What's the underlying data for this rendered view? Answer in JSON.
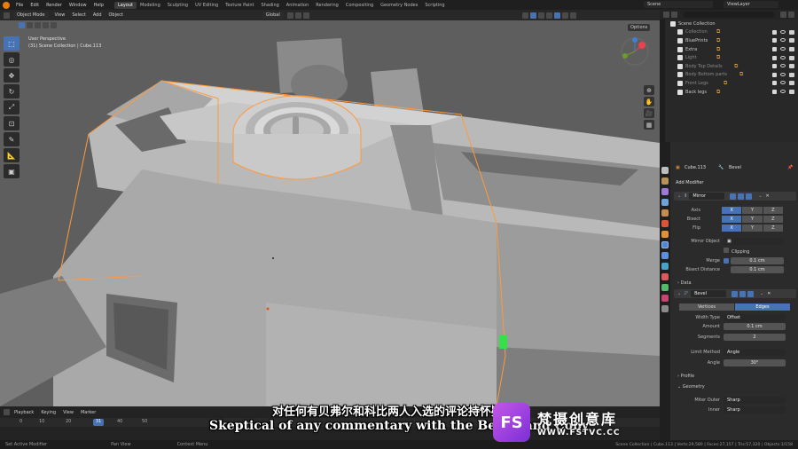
{
  "menu": {
    "items": [
      "File",
      "Edit",
      "Render",
      "Window",
      "Help"
    ],
    "workspaces": [
      "Layout",
      "Modeling",
      "Sculpting",
      "UV Editing",
      "Texture Paint",
      "Shading",
      "Animation",
      "Rendering",
      "Compositing",
      "Geometry Nodes",
      "Scripting"
    ],
    "active_workspace": "Layout",
    "scene": "Scene",
    "view_layer": "ViewLayer"
  },
  "viewport": {
    "mode": "Object Mode",
    "menus": [
      "View",
      "Select",
      "Add",
      "Object"
    ],
    "transform_orientation": "Global",
    "options": "Options",
    "perspective_label": "User Perspective",
    "collection_label": "(31) Scene Collection | Cube.113"
  },
  "outliner": {
    "root": "Scene Collection",
    "items": [
      {
        "name": "Collection",
        "dim": true
      },
      {
        "name": "BluePrints",
        "dim": false
      },
      {
        "name": "Extra",
        "dim": false
      },
      {
        "name": "Light",
        "dim": true
      },
      {
        "name": "Body Top Details",
        "dim": true
      },
      {
        "name": "Body Bottom parts",
        "dim": true
      },
      {
        "name": "Front Legs",
        "dim": true
      },
      {
        "name": "Back legs",
        "dim": false
      }
    ]
  },
  "properties": {
    "object_name": "Cube.113",
    "modifier_name_header": "Bevel",
    "add_modifier": "Add Modifier",
    "mirror": {
      "name": "Mirror",
      "axis_label": "Axis",
      "bisect_label": "Bisect",
      "flip_label": "Flip",
      "axes": [
        "X",
        "Y",
        "Z"
      ],
      "mirror_object_label": "Mirror Object",
      "clipping_label": "Clipping",
      "merge_label": "Merge",
      "merge_value": "0.1 cm",
      "bisect_distance_label": "Bisect Distance",
      "bisect_distance_value": "0.1 cm",
      "data_label": "Data"
    },
    "bevel": {
      "name": "Bevel",
      "vertices_tab": "Vertices",
      "edges_tab": "Edges",
      "width_type_label": "Width Type",
      "width_type_value": "Offset",
      "amount_label": "Amount",
      "amount_value": "0.1 cm",
      "segments_label": "Segments",
      "segments_value": "2",
      "limit_method_label": "Limit Method",
      "limit_method_value": "Angle",
      "angle_label": "Angle",
      "angle_value": "30°",
      "profile_label": "Profile",
      "geometry_label": "Geometry",
      "miter_outer_label": "Miter Outer",
      "miter_outer_value": "Sharp",
      "inner_label": "Inner",
      "inner_value": "Sharp"
    }
  },
  "timeline": {
    "menus": [
      "Playback",
      "Keying",
      "View",
      "Marker"
    ],
    "ticks": [
      "0",
      "10",
      "20",
      "31",
      "40",
      "50"
    ],
    "current_frame": "31"
  },
  "status": {
    "left": "Set Active Modifier",
    "pan": "Pan View",
    "context": "Context Menu",
    "right": "Scene Collection | Cube.113 | Verts:29,580 | Faces:27,157 | Tris:57,320 | Objects:1/158"
  },
  "subtitles": {
    "chinese": "对任何有贝弗尔和科比两人入选的评论持怀疑态度",
    "english": "Skeptical of any commentary with the Bevell and Coby"
  },
  "watermark": {
    "logo": "FS",
    "cn": "梵摄创意库",
    "url": "WWW.FSTVC.CC"
  }
}
